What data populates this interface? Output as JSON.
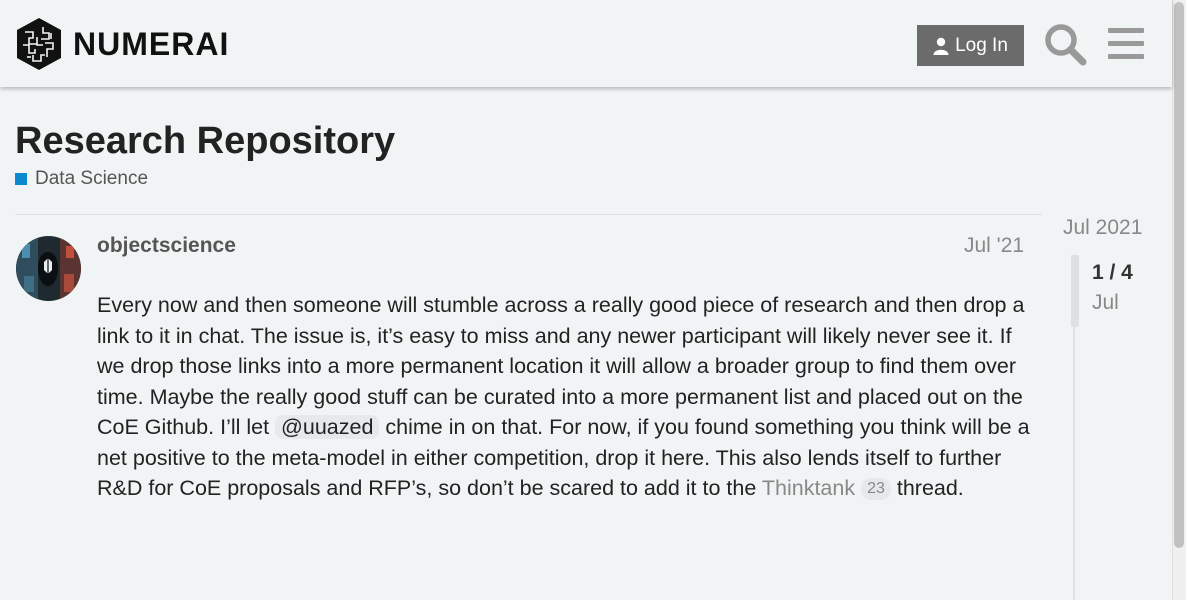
{
  "header": {
    "logo_text": "NUMERAI",
    "login_label": "Log In",
    "search_icon": "search-icon",
    "menu_icon": "hamburger-menu-icon"
  },
  "topic": {
    "title": "Research Repository",
    "category": "Data Science",
    "category_color": "#0e89d0"
  },
  "post": {
    "username": "objectscience",
    "date": "Jul '21",
    "text_1": "Every now and then someone will stumble across a really good piece of research and then drop a link to it in chat. The issue is, it’s easy to miss and any newer participant will likely never see it. If we drop those links into a more permanent location it will allow a broader group to find them over time. Maybe the really good stuff can be curated into a more permanent list and placed out on the CoE Github. I’ll let ",
    "mention": "@uuazed",
    "text_2": " chime in on that. For now, if you found something you think will be a net positive to the meta-model in either competition, drop it here. This also lends itself to further R&D for CoE proposals and RFP’s, so don’t be scared to add it to the ",
    "link_text": "Thinktank",
    "link_count": "23",
    "text_3": " thread."
  },
  "timeline": {
    "start_label": "Jul 2021",
    "position": "1 / 4",
    "month": "Jul"
  }
}
